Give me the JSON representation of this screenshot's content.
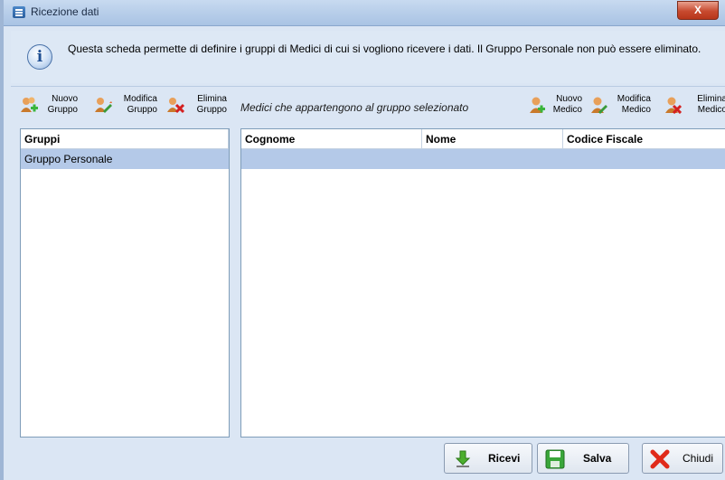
{
  "window": {
    "title": "Ricezione dati",
    "close_label": "X"
  },
  "info": {
    "icon": "info-icon",
    "text": "Questa scheda permette di definire i gruppi di Medici di cui si vogliono ricevere i dati. Il Gruppo Personale non può essere eliminato."
  },
  "groups_toolbar": {
    "new": {
      "line1": "Nuovo",
      "line2": "Gruppo",
      "icon": "add-group-icon"
    },
    "edit": {
      "line1": "Modifica",
      "line2": "Gruppo",
      "icon": "edit-group-icon"
    },
    "delete": {
      "line1": "Elimina",
      "line2": "Gruppo",
      "icon": "delete-group-icon"
    }
  },
  "doctors_header": "Medici che appartengono al gruppo selezionato",
  "doctors_toolbar": {
    "new": {
      "line1": "Nuovo",
      "line2": "Medico",
      "icon": "add-doctor-icon"
    },
    "edit": {
      "line1": "Modifica",
      "line2": "Medico",
      "icon": "edit-doctor-icon"
    },
    "delete": {
      "line1": "Elimina",
      "line2": "Medico",
      "icon": "delete-doctor-icon"
    }
  },
  "groups_list": {
    "header": "Gruppi",
    "rows": [
      "Gruppo Personale"
    ],
    "selected_index": 0
  },
  "doctors_table": {
    "columns": [
      "Cognome",
      "Nome",
      "Codice Fiscale"
    ],
    "rows": []
  },
  "buttons": {
    "receive": "Ricevi",
    "save": "Salva",
    "close": "Chiudi"
  },
  "colors": {
    "selection": "#b4c9e8",
    "window_bg": "#dbe6f4",
    "close_red": "#c74a2f"
  }
}
